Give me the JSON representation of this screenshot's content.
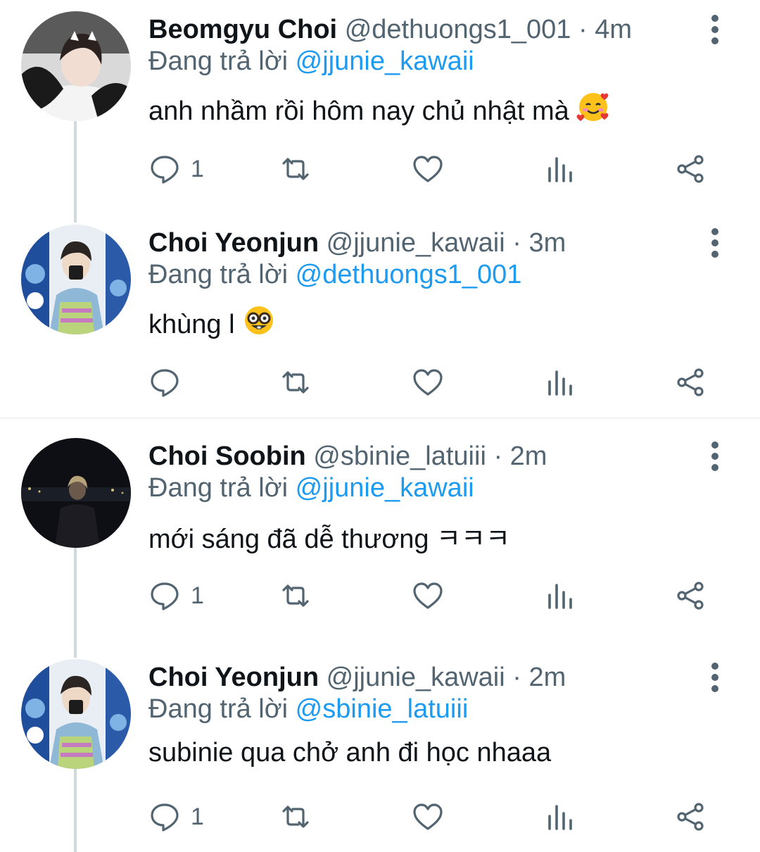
{
  "tweets": [
    {
      "name": "Beomgyu Choi",
      "handle": "@dethuongs1_001 · 4m",
      "replying_prefix": "Đang trả lời",
      "replying_to": "@jjunie_kawaii",
      "text": "anh nhầm rồi hôm nay chủ nhật mà",
      "emoji": "smiling-face-with-hearts",
      "reply_count": "1"
    },
    {
      "name": "Choi Yeonjun",
      "handle": "@jjunie_kawaii · 3m",
      "replying_prefix": "Đang trả lời",
      "replying_to": "@dethuongs1_001",
      "text": "khùng l",
      "emoji": "nerd-face",
      "reply_count": ""
    },
    {
      "name": "Choi Soobin",
      "handle": "@sbinie_latuiii · 2m",
      "replying_prefix": "Đang trả lời",
      "replying_to": "@jjunie_kawaii",
      "text": "mới sáng đã dễ thương ㅋㅋㅋ",
      "emoji": "",
      "reply_count": "1"
    },
    {
      "name": "Choi Yeonjun",
      "handle": "@jjunie_kawaii · 2m",
      "replying_prefix": "Đang trả lời",
      "replying_to": "@sbinie_latuiii",
      "text": "subinie qua chở anh đi học nhaaa",
      "emoji": "",
      "reply_count": "1"
    }
  ],
  "colors": {
    "name": "#0f1419",
    "secondary": "#536471",
    "mention": "#1d9bf0",
    "thread_line": "#cfd9de"
  }
}
